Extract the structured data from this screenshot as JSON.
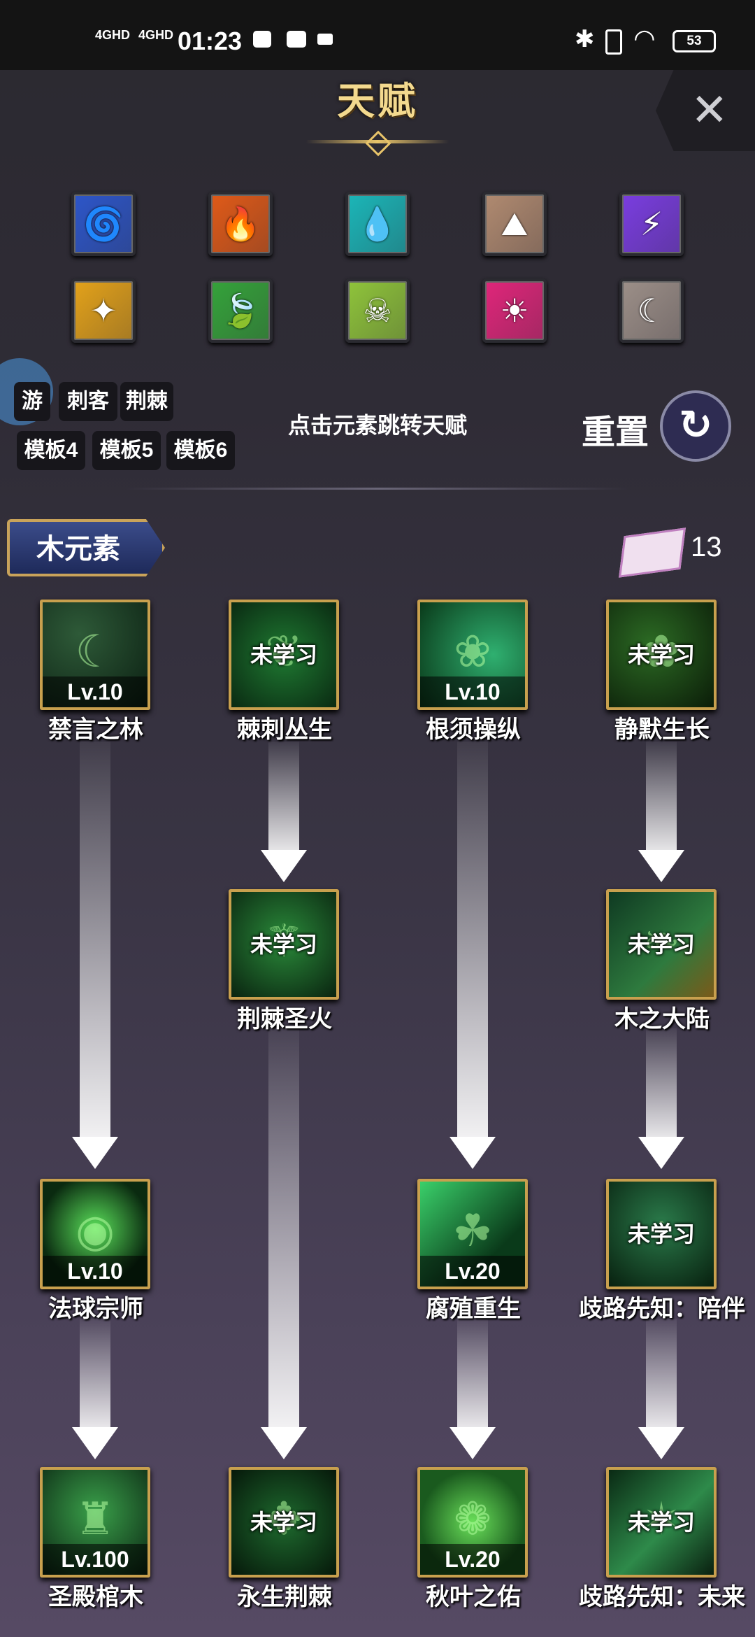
{
  "status_bar": {
    "sig1": "4GHD",
    "sig2": "4GHD",
    "time": "01:23",
    "battery": "53"
  },
  "header": {
    "title": "天赋",
    "close": "✕"
  },
  "elements": [
    {
      "icon": "whirlwind-icon",
      "glyph": "🌀",
      "color": "#2d56c9"
    },
    {
      "icon": "fire-icon",
      "glyph": "🔥",
      "color": "#e05a18"
    },
    {
      "icon": "water-drop-icon",
      "glyph": "💧",
      "color": "#1bb6b8"
    },
    {
      "icon": "earth-icon",
      "glyph": "⛰",
      "color": "#b08a70"
    },
    {
      "icon": "lightning-icon",
      "glyph": "⚡",
      "color": "#7a3de0"
    },
    {
      "icon": "light-icon",
      "glyph": "✦",
      "color": "#e3a21a"
    },
    {
      "icon": "leaf-icon",
      "glyph": "🍃",
      "color": "#35a33a"
    },
    {
      "icon": "poison-skull-icon",
      "glyph": "☠",
      "color": "#8fc43a"
    },
    {
      "icon": "sun-icon",
      "glyph": "☀",
      "color": "#e0267a"
    },
    {
      "icon": "moon-icon",
      "glyph": "☾",
      "color": "#9c8f88"
    }
  ],
  "templates": {
    "row1": [
      "游",
      "刺客",
      "荆棘"
    ],
    "row2": [
      "模板4",
      "模板5",
      "模板6"
    ]
  },
  "hint": "点击元素跳转天赋",
  "reset_label": "重置",
  "section": {
    "element_name": "木元素",
    "points": "13"
  },
  "talents": {
    "t1": {
      "name": "禁言之林",
      "level": "Lv.10",
      "state": "",
      "icon": "moon-forest-icon",
      "glyph": "☾"
    },
    "t2": {
      "name": "棘刺丛生",
      "level": "",
      "state": "未学习",
      "icon": "thorn-vines-icon",
      "glyph": "❦"
    },
    "t3": {
      "name": "根须操纵",
      "level": "Lv.10",
      "state": "",
      "icon": "roots-icon",
      "glyph": "❀"
    },
    "t4": {
      "name": "静默生长",
      "level": "",
      "state": "未学习",
      "icon": "growth-icon",
      "glyph": "✿"
    },
    "t5": {
      "name": "荆棘圣火",
      "level": "",
      "state": "未学习",
      "icon": "thorn-staff-icon",
      "glyph": "⚚"
    },
    "t6": {
      "name": "木之大陆",
      "level": "",
      "state": "未学习",
      "icon": "forest-land-icon",
      "glyph": "❧"
    },
    "t7": {
      "name": "法球宗师",
      "level": "Lv.10",
      "state": "",
      "icon": "orb-master-icon",
      "glyph": "◉"
    },
    "t8": {
      "name": "腐殖重生",
      "level": "Lv.20",
      "state": "",
      "icon": "humus-rebirth-icon",
      "glyph": "☘"
    },
    "t9": {
      "name": "歧路先知：陪伴",
      "level": "",
      "state": "未学习",
      "icon": "prophet-companion-icon",
      "glyph": "♆"
    },
    "t10": {
      "name": "圣殿棺木",
      "level": "Lv.100",
      "state": "",
      "icon": "temple-coffin-icon",
      "glyph": "♜"
    },
    "t11": {
      "name": "永生荆棘",
      "level": "",
      "state": "未学习",
      "icon": "eternal-thorn-icon",
      "glyph": "✥"
    },
    "t12": {
      "name": "秋叶之佑",
      "level": "Lv.20",
      "state": "",
      "icon": "autumn-leaf-icon",
      "glyph": "❁"
    },
    "t13": {
      "name": "歧路先知：未来",
      "level": "",
      "state": "未学习",
      "icon": "prophet-future-icon",
      "glyph": "✶"
    }
  }
}
